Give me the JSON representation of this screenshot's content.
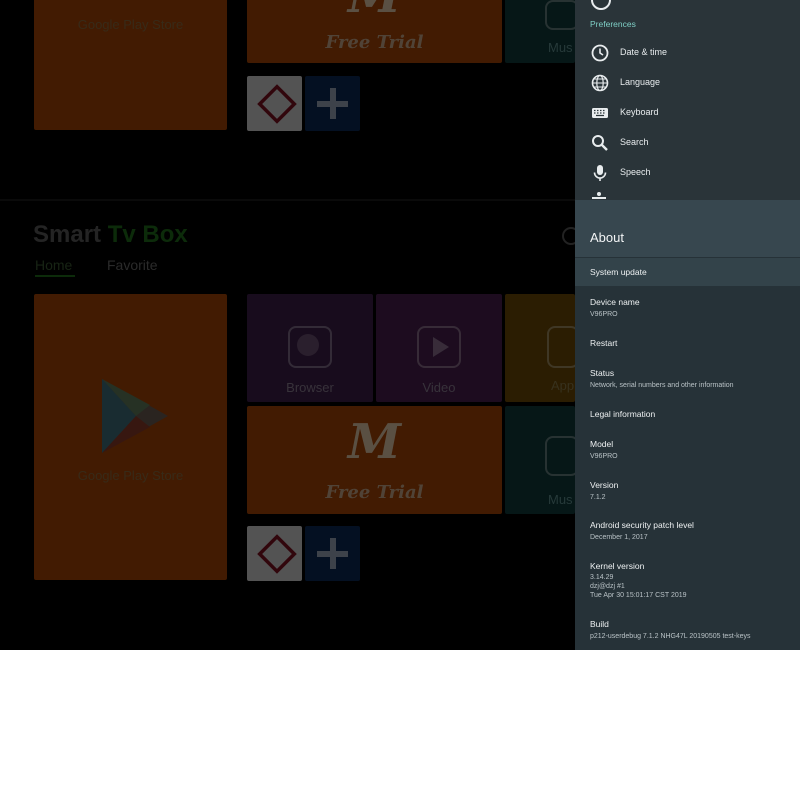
{
  "launcher": {
    "brand_smart": "Smart",
    "brand_tv": "Tv",
    "brand_box": "Box",
    "tabs": [
      "Home",
      "Favorite"
    ],
    "tiles": {
      "play_store": "Google Play Store",
      "free_trial": "Free Trial",
      "browser": "Browser",
      "video": "Video",
      "apps": "App",
      "music": "Mus"
    },
    "colors": {
      "brand_green": "#1f6b1a",
      "accent_orange": "#a64405"
    }
  },
  "settings": {
    "preferences_header": "Preferences",
    "preferences": [
      {
        "label": "Date & time",
        "icon": "clock-icon"
      },
      {
        "label": "Language",
        "icon": "globe-icon"
      },
      {
        "label": "Keyboard",
        "icon": "keyboard-icon"
      },
      {
        "label": "Search",
        "icon": "search-icon"
      },
      {
        "label": "Speech",
        "icon": "microphone-icon"
      }
    ],
    "about_title": "About",
    "rows": [
      {
        "title": "System update"
      },
      {
        "title": "Device name",
        "value": "V96PRO"
      },
      {
        "title": "Restart"
      },
      {
        "title": "Status",
        "value": "Network, serial numbers and other information"
      },
      {
        "title": "Legal information"
      },
      {
        "title": "Model",
        "value": "V96PRO"
      },
      {
        "title": "Version",
        "value": "7.1.2"
      },
      {
        "title": "Android security patch level",
        "value": "December 1, 2017"
      },
      {
        "title": "Kernel version",
        "value_lines": [
          "3.14.29",
          "dzj@dzj #1",
          "Tue Apr 30 15:01:17 CST 2019"
        ]
      },
      {
        "title": "Build",
        "value": "p212-userdebug 7.1.2 NHG47L 20190505 test-keys"
      }
    ],
    "colors": {
      "panel_bg": "#263238",
      "header_bg": "#37474f",
      "pref_accent": "#7fcfc6"
    }
  }
}
